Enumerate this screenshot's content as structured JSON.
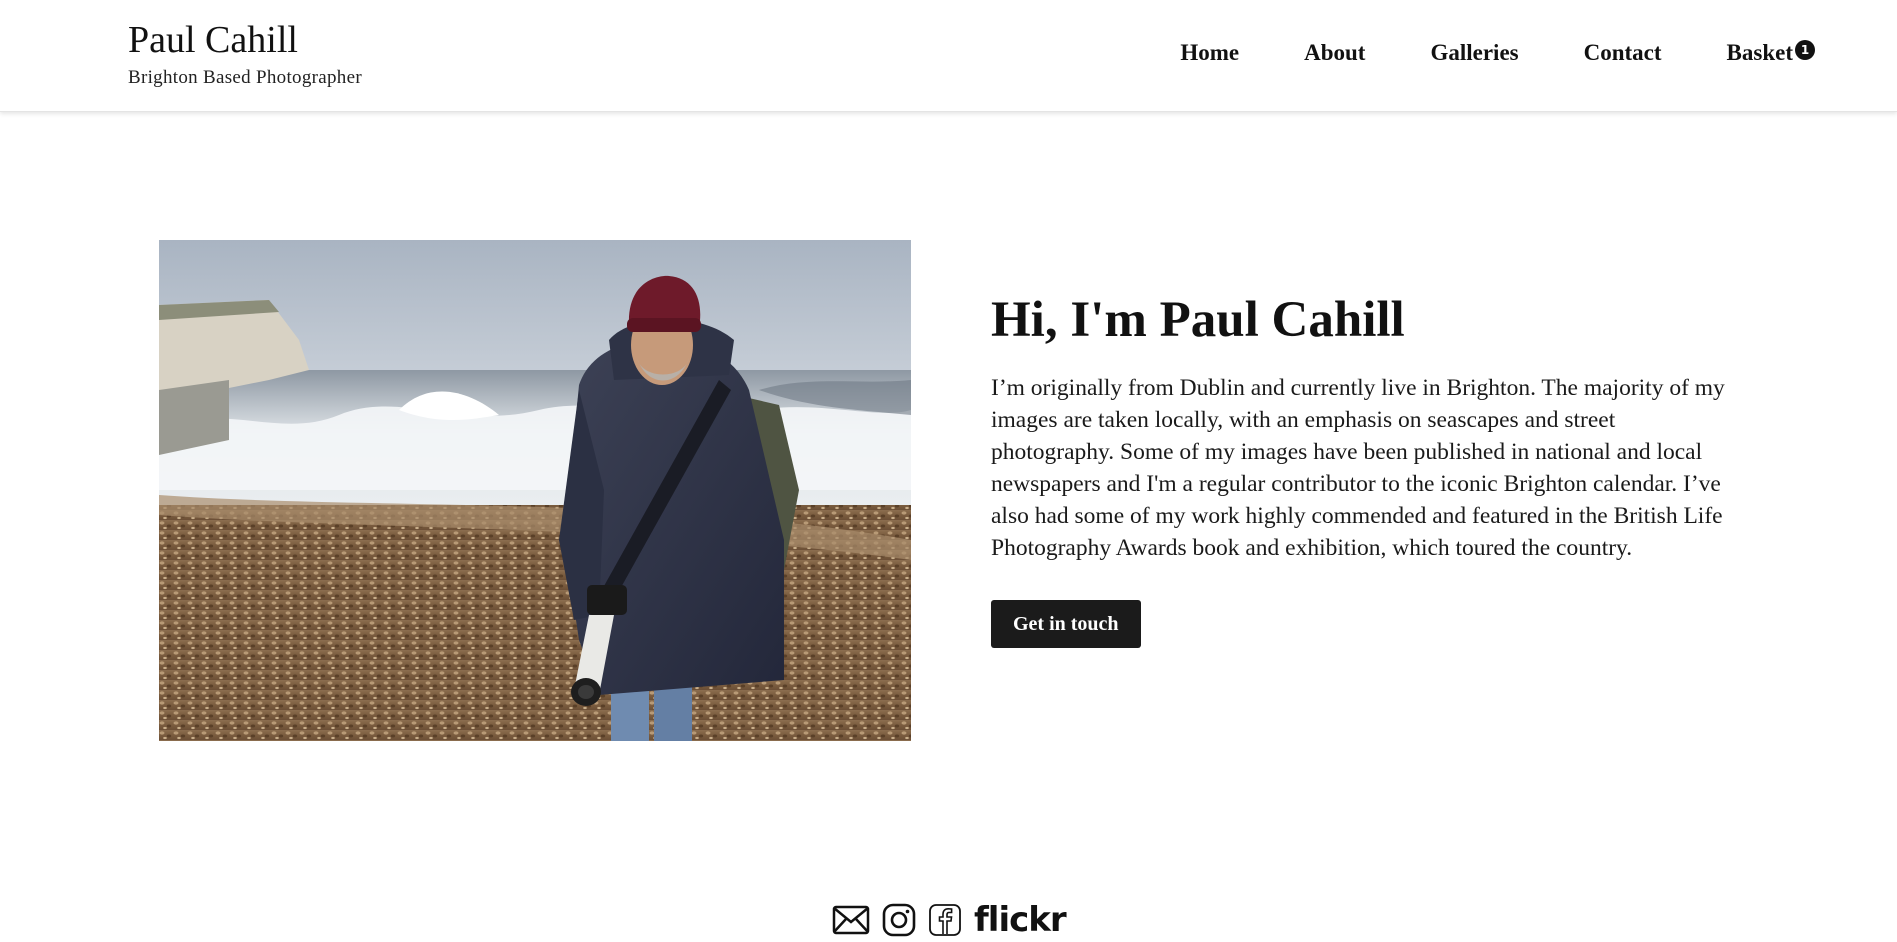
{
  "brand": {
    "name": "Paul Cahill",
    "tagline": "Brighton Based Photographer"
  },
  "nav": {
    "items": [
      {
        "label": "Home"
      },
      {
        "label": "About"
      },
      {
        "label": "Galleries"
      },
      {
        "label": "Contact"
      },
      {
        "label": "Basket",
        "badge": "1"
      }
    ]
  },
  "hero": {
    "photo_description_icon": "portrait-photo",
    "heading": "Hi, I'm Paul Cahill",
    "body": "I’m originally from Dublin and currently live in Brighton. The majority of my images are taken locally, with an emphasis on seascapes and street photography. Some of my images have been published in national and local newspapers and I'm a regular contributor to the iconic Brighton calendar. I’ve also had some of my work highly commended and featured in the British Life Photography Awards book and exhibition, which toured the country.",
    "cta_label": "Get in touch"
  },
  "social": {
    "icons": [
      "envelope-icon",
      "instagram-icon",
      "facebook-icon"
    ],
    "flickr_label": "flickr"
  },
  "colors": {
    "text": "#111111",
    "button_bg": "#1b1b1b",
    "button_text": "#ffffff",
    "background": "#ffffff"
  }
}
